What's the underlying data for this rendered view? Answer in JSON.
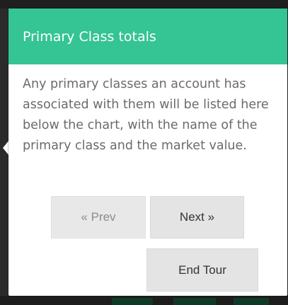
{
  "tour": {
    "title": "Primary Class totals",
    "body": "Any primary classes an account has associated with them will be listed here below the chart, with the name of the primary class and the market value.",
    "buttons": {
      "prev": "« Prev",
      "next": "Next »",
      "end": "End Tour"
    }
  },
  "colors": {
    "header": "#35c493",
    "button": "#e4e4e4"
  }
}
